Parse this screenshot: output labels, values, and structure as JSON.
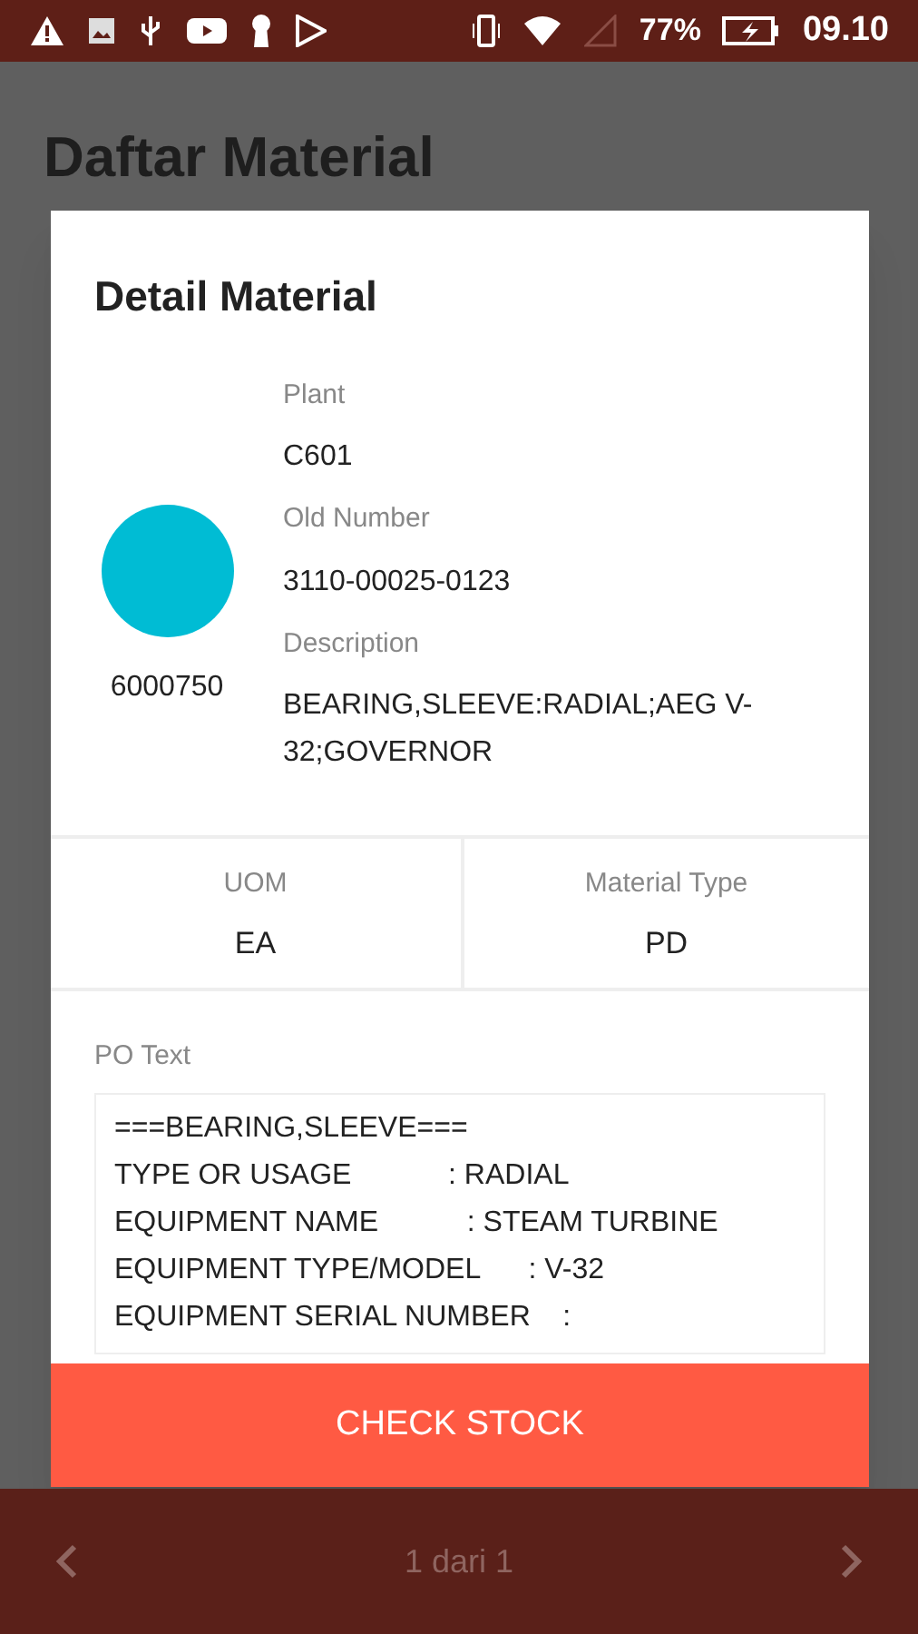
{
  "status_bar": {
    "battery": "77%",
    "time": "09.10"
  },
  "page": {
    "title": "Daftar Material"
  },
  "dialog": {
    "title": "Detail Material",
    "material_number": "6000750",
    "fields": [
      {
        "label": "Plant",
        "value": "C601"
      },
      {
        "label": "Old Number",
        "value": "3110-00025-0123"
      },
      {
        "label": "Description",
        "value": "BEARING,SLEEVE:RADIAL;AEG V-32;GOVERNOR"
      }
    ],
    "summary": [
      {
        "label": "UOM",
        "value": "EA"
      },
      {
        "label": "Material Type",
        "value": "PD"
      }
    ],
    "po_text": {
      "label": "PO Text",
      "lines": [
        "===BEARING,SLEEVE===",
        "TYPE OR USAGE            : RADIAL",
        "EQUIPMENT NAME           : STEAM TURBINE",
        "EQUIPMENT TYPE/MODEL      : V-32",
        "EQUIPMENT SERIAL NUMBER    :"
      ]
    },
    "button": "CHECK STOCK"
  },
  "pager": {
    "text": "1 dari 1"
  }
}
